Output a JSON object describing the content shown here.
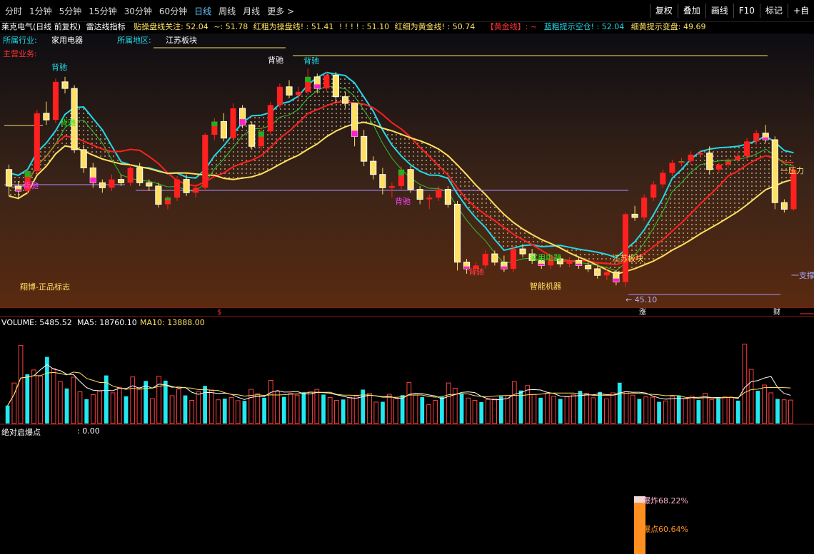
{
  "toolbar": {
    "tabs": [
      "分时",
      "1分钟",
      "5分钟",
      "15分钟",
      "30分钟",
      "60分钟",
      "日线",
      "周线",
      "月线",
      "更多 >"
    ],
    "active": "日线",
    "right": [
      "复权",
      "叠加",
      "画线",
      "F10",
      "标记",
      "+自"
    ]
  },
  "info": {
    "stock": "莱克电气(日线 前复权)",
    "indicator": "雷达线指标",
    "seg1_label": "贴操盘线关注: 52.04",
    "seg2_label": "~: 51.78",
    "seg3_label": "红粗为操盘线! : 51.41",
    "seg4_label": "! ! ! ! : 51.10",
    "seg5_label": "红细为黄金线! : 50.74",
    "seg6_label": "【黄金线】: ~",
    "seg7_label": "蓝粗提示空仓! : 52.04",
    "seg8_label": "细黄提示变盘: 49.69"
  },
  "tags": {
    "industry_label": "所属行业:",
    "industry_value": "家用电器",
    "region_label": "所属地区:",
    "region_value": "江苏板块",
    "business_label": "主营业务:",
    "watermark": "翔博-正品标志"
  },
  "annotations": {
    "beichi": "背驰",
    "home_appliance": "家用电器",
    "smart_machine": "智能机器",
    "jiangsu": "江苏板块",
    "low_price": "← 45.10",
    "resistance": "一压力",
    "support": "一支撑",
    "markers": [
      "$",
      "涨",
      "财"
    ]
  },
  "volume_header": {
    "label": "VOLUME: 5485.52",
    "ma5": "MA5: 18760.10",
    "ma10": "MA10: 13888.00"
  },
  "bottom_panel": {
    "title": "绝对启爆点",
    "value": ": 0.00",
    "bar_a_label": "爆炸68.22%",
    "bar_a_value": 68.22,
    "bar_b_label": "爆点60.64%",
    "bar_b_value": 60.64
  },
  "colors": {
    "up": "#ff2020",
    "down_yellow": "#ffe060",
    "cyan": "#22d8e8",
    "magenta": "#ff20d0",
    "green": "#20b020",
    "redline": "#ff2020"
  },
  "chart_data": {
    "type": "candlestick",
    "price_range": [
      44,
      59
    ],
    "ohlc": [
      [
        52.2,
        52.5,
        50.6,
        51.2
      ],
      [
        51.2,
        51.5,
        50.4,
        50.9
      ],
      [
        50.9,
        52.2,
        50.7,
        52.1
      ],
      [
        52.1,
        55.8,
        51.9,
        55.6
      ],
      [
        55.6,
        56.3,
        54.9,
        55.2
      ],
      [
        55.2,
        57.7,
        55.0,
        57.5
      ],
      [
        57.5,
        57.8,
        56.8,
        57.1
      ],
      [
        57.1,
        57.3,
        53.2,
        53.4
      ],
      [
        53.4,
        53.7,
        52.0,
        52.3
      ],
      [
        52.3,
        52.6,
        51.1,
        51.4
      ],
      [
        51.4,
        51.6,
        50.8,
        51.1
      ],
      [
        51.1,
        51.9,
        50.9,
        51.6
      ],
      [
        51.6,
        51.9,
        51.2,
        51.4
      ],
      [
        51.4,
        52.5,
        51.2,
        52.3
      ],
      [
        52.3,
        52.6,
        51.2,
        51.4
      ],
      [
        51.4,
        51.6,
        50.9,
        51.2
      ],
      [
        51.2,
        51.4,
        49.9,
        50.1
      ],
      [
        50.1,
        50.6,
        49.8,
        50.5
      ],
      [
        50.5,
        51.8,
        50.3,
        51.6
      ],
      [
        51.6,
        51.9,
        50.6,
        50.8
      ],
      [
        50.8,
        51.3,
        50.5,
        51.1
      ],
      [
        51.1,
        54.4,
        50.9,
        54.3
      ],
      [
        54.3,
        55.3,
        54.0,
        55.1
      ],
      [
        55.1,
        55.6,
        53.9,
        54.1
      ],
      [
        54.1,
        56.2,
        53.9,
        55.9
      ],
      [
        55.9,
        56.1,
        54.7,
        54.9
      ],
      [
        54.9,
        55.1,
        53.4,
        53.6
      ],
      [
        53.6,
        54.7,
        53.3,
        54.5
      ],
      [
        54.5,
        56.3,
        54.3,
        56.1
      ],
      [
        56.1,
        57.4,
        55.9,
        57.2
      ],
      [
        57.2,
        57.6,
        56.5,
        56.7
      ],
      [
        56.7,
        57.2,
        56.3,
        56.9
      ],
      [
        56.9,
        58.3,
        56.7,
        57.8
      ],
      [
        57.8,
        58.0,
        56.8,
        57.1
      ],
      [
        57.1,
        58.1,
        56.9,
        57.9
      ],
      [
        57.9,
        58.1,
        56.2,
        56.6
      ],
      [
        56.6,
        56.9,
        55.9,
        56.2
      ],
      [
        56.2,
        55.9,
        53.6,
        54.2
      ],
      [
        54.2,
        54.6,
        52.4,
        52.7
      ],
      [
        52.7,
        53.0,
        51.6,
        51.9
      ],
      [
        51.9,
        52.3,
        50.7,
        51.1
      ],
      [
        51.1,
        51.4,
        50.5,
        51.2
      ],
      [
        51.2,
        52.4,
        51.0,
        52.2
      ],
      [
        52.2,
        52.4,
        50.8,
        51.0
      ],
      [
        51.0,
        51.2,
        50.1,
        50.4
      ],
      [
        50.4,
        50.7,
        49.8,
        50.5
      ],
      [
        50.5,
        51.2,
        50.3,
        51.0
      ],
      [
        51.0,
        51.2,
        49.9,
        50.1
      ],
      [
        50.1,
        50.3,
        46.1,
        46.6
      ],
      [
        46.6,
        46.8,
        45.9,
        46.2
      ],
      [
        46.2,
        46.6,
        45.9,
        46.4
      ],
      [
        46.4,
        47.3,
        46.2,
        47.1
      ],
      [
        47.1,
        47.3,
        46.4,
        46.6
      ],
      [
        46.6,
        47.0,
        46.0,
        46.2
      ],
      [
        46.2,
        47.6,
        46.0,
        47.4
      ],
      [
        47.4,
        47.7,
        46.9,
        47.1
      ],
      [
        47.1,
        47.4,
        46.5,
        46.7
      ],
      [
        46.7,
        47.0,
        46.2,
        46.4
      ],
      [
        46.4,
        46.9,
        46.2,
        46.8
      ],
      [
        46.8,
        47.0,
        46.3,
        46.5
      ],
      [
        46.5,
        46.9,
        46.3,
        46.7
      ],
      [
        46.7,
        46.9,
        46.2,
        46.4
      ],
      [
        46.4,
        46.6,
        46.0,
        46.2
      ],
      [
        46.2,
        46.4,
        45.6,
        45.8
      ],
      [
        45.8,
        46.2,
        45.5,
        46.0
      ],
      [
        46.0,
        46.1,
        45.2,
        45.4
      ],
      [
        45.4,
        49.6,
        45.1,
        49.5
      ],
      [
        49.5,
        50.0,
        49.1,
        49.3
      ],
      [
        49.3,
        50.7,
        49.1,
        50.5
      ],
      [
        50.5,
        51.5,
        50.3,
        51.3
      ],
      [
        51.3,
        52.2,
        51.1,
        52.0
      ],
      [
        52.0,
        52.8,
        51.8,
        52.6
      ],
      [
        52.6,
        52.9,
        52.4,
        52.7
      ],
      [
        52.7,
        53.3,
        52.5,
        53.1
      ],
      [
        53.1,
        53.4,
        52.9,
        53.2
      ],
      [
        53.2,
        53.6,
        51.9,
        52.2
      ],
      [
        52.2,
        52.6,
        52.0,
        52.5
      ],
      [
        52.5,
        52.9,
        52.3,
        52.8
      ],
      [
        52.8,
        53.2,
        52.6,
        53.0
      ],
      [
        53.0,
        54.1,
        52.8,
        53.9
      ],
      [
        53.9,
        54.6,
        53.7,
        54.4
      ],
      [
        54.4,
        54.9,
        53.8,
        54.0
      ],
      [
        54.0,
        54.2,
        49.8,
        50.2
      ],
      [
        50.2,
        50.4,
        49.6,
        49.8
      ],
      [
        49.8,
        52.4,
        49.7,
        52.2
      ]
    ],
    "volume_range": [
      0,
      33000
    ],
    "volume": [
      6200,
      14000,
      27000,
      17000,
      18500,
      16400,
      23000,
      19000,
      14500,
      12100,
      16000,
      11000,
      8400,
      10000,
      11200,
      16600,
      10600,
      12500,
      9400,
      16100,
      12400,
      14700,
      8600,
      16300,
      14800,
      9600,
      11900,
      9700,
      8000,
      11100,
      13000,
      11600,
      8200,
      8600,
      9000,
      7900,
      7800,
      11800,
      10300,
      8900,
      14900,
      11100,
      9200,
      10400,
      9800,
      10800,
      10900,
      11800,
      10000,
      9000,
      8000,
      8300,
      9000,
      9400,
      11700,
      10400,
      7400,
      7500,
      10100,
      8600,
      9800,
      14200,
      9800,
      9100,
      6500,
      8000,
      9200,
      14000,
      12200,
      10400,
      8800,
      8000,
      7400,
      8300,
      8500,
      9400,
      9700,
      14500,
      11400,
      13100,
      10000,
      8900,
      10500,
      9400,
      8500,
      9200,
      9900,
      11300,
      10400,
      8900,
      10900,
      8500,
      10600,
      14100,
      11000,
      9800,
      8500,
      9200,
      9100,
      7500,
      7800,
      9400,
      9700,
      8500,
      9500,
      8100,
      10400,
      8300,
      8600,
      9300,
      8900,
      7900,
      27400,
      18700,
      11300,
      13300,
      10600,
      8500,
      8200,
      8100
    ],
    "series": [
      {
        "name": "MA5",
        "values": []
      },
      {
        "name": "MA10",
        "values": []
      }
    ]
  }
}
